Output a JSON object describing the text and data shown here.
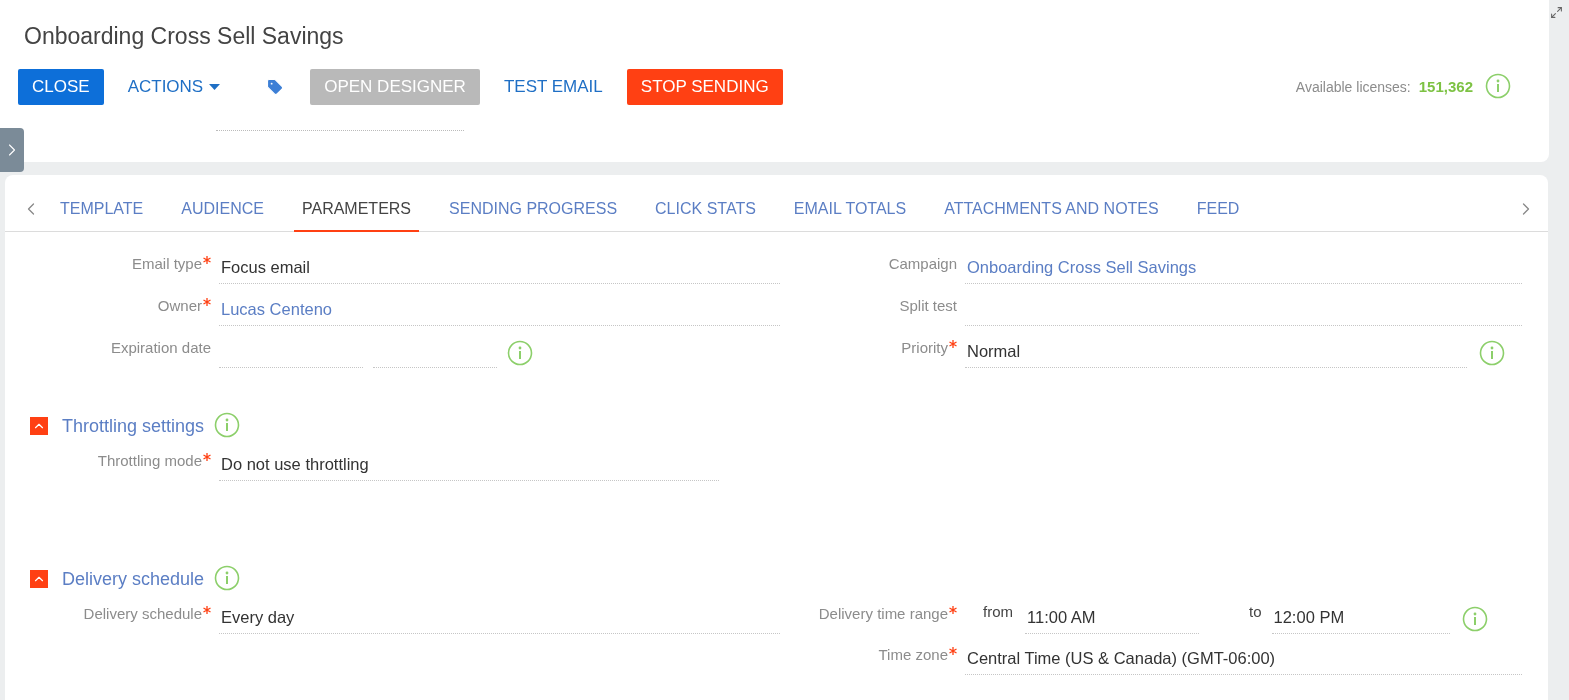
{
  "header": {
    "title": "Onboarding Cross Sell Savings",
    "buttons": [
      {
        "kind": "primary",
        "label": "CLOSE"
      },
      {
        "kind": "dropdown",
        "label": "ACTIONS"
      },
      {
        "kind": "tag"
      },
      {
        "kind": "disabled",
        "label": "OPEN DESIGNER"
      },
      {
        "kind": "link",
        "label": "TEST EMAIL"
      },
      {
        "kind": "danger",
        "label": "STOP SENDING"
      }
    ],
    "licenses": {
      "label": "Available licenses:",
      "value": "151,362"
    }
  },
  "tabs": [
    {
      "label": "TEMPLATE",
      "selected": false
    },
    {
      "label": "AUDIENCE",
      "selected": false
    },
    {
      "label": "PARAMETERS",
      "selected": true
    },
    {
      "label": "SENDING PROGRESS",
      "selected": false
    },
    {
      "label": "CLICK STATS",
      "selected": false
    },
    {
      "label": "EMAIL TOTALS",
      "selected": false
    },
    {
      "label": "ATTACHMENTS AND NOTES",
      "selected": false
    },
    {
      "label": "FEED",
      "selected": false
    }
  ],
  "general": {
    "left": [
      {
        "kind": "text",
        "label": "Email type",
        "required": true,
        "value": "Focus email"
      },
      {
        "kind": "link",
        "label": "Owner",
        "required": true,
        "value": "Lucas Centeno"
      },
      {
        "kind": "date_pair",
        "label": "Expiration date",
        "required": false,
        "info": true
      }
    ],
    "right": [
      {
        "kind": "link",
        "label": "Campaign",
        "required": false,
        "value": "Onboarding Cross Sell Savings"
      },
      {
        "kind": "text",
        "label": "Split test",
        "required": false
      },
      {
        "kind": "text",
        "label": "Priority",
        "required": true,
        "value": "Normal",
        "info": true
      }
    ]
  },
  "sections": [
    {
      "title": "Throttling settings",
      "expanded": true,
      "left": [
        {
          "kind": "text",
          "label": "Throttling mode",
          "required": true,
          "value": "Do not use throttling"
        }
      ]
    },
    {
      "title": "Delivery schedule",
      "expanded": true,
      "left": [
        {
          "kind": "text",
          "label": "Delivery schedule",
          "required": true,
          "value": "Every day"
        }
      ],
      "right": [
        {
          "kind": "time_range",
          "label": "Delivery time range",
          "required": true,
          "from_label": "from",
          "from_value": "11:00 AM",
          "to_label": "to",
          "to_value": "12:00 PM",
          "info": true
        },
        {
          "kind": "text",
          "label": "Time zone",
          "required": true,
          "value": "Central Time (US & Canada) (GMT-06:00)"
        }
      ]
    }
  ]
}
